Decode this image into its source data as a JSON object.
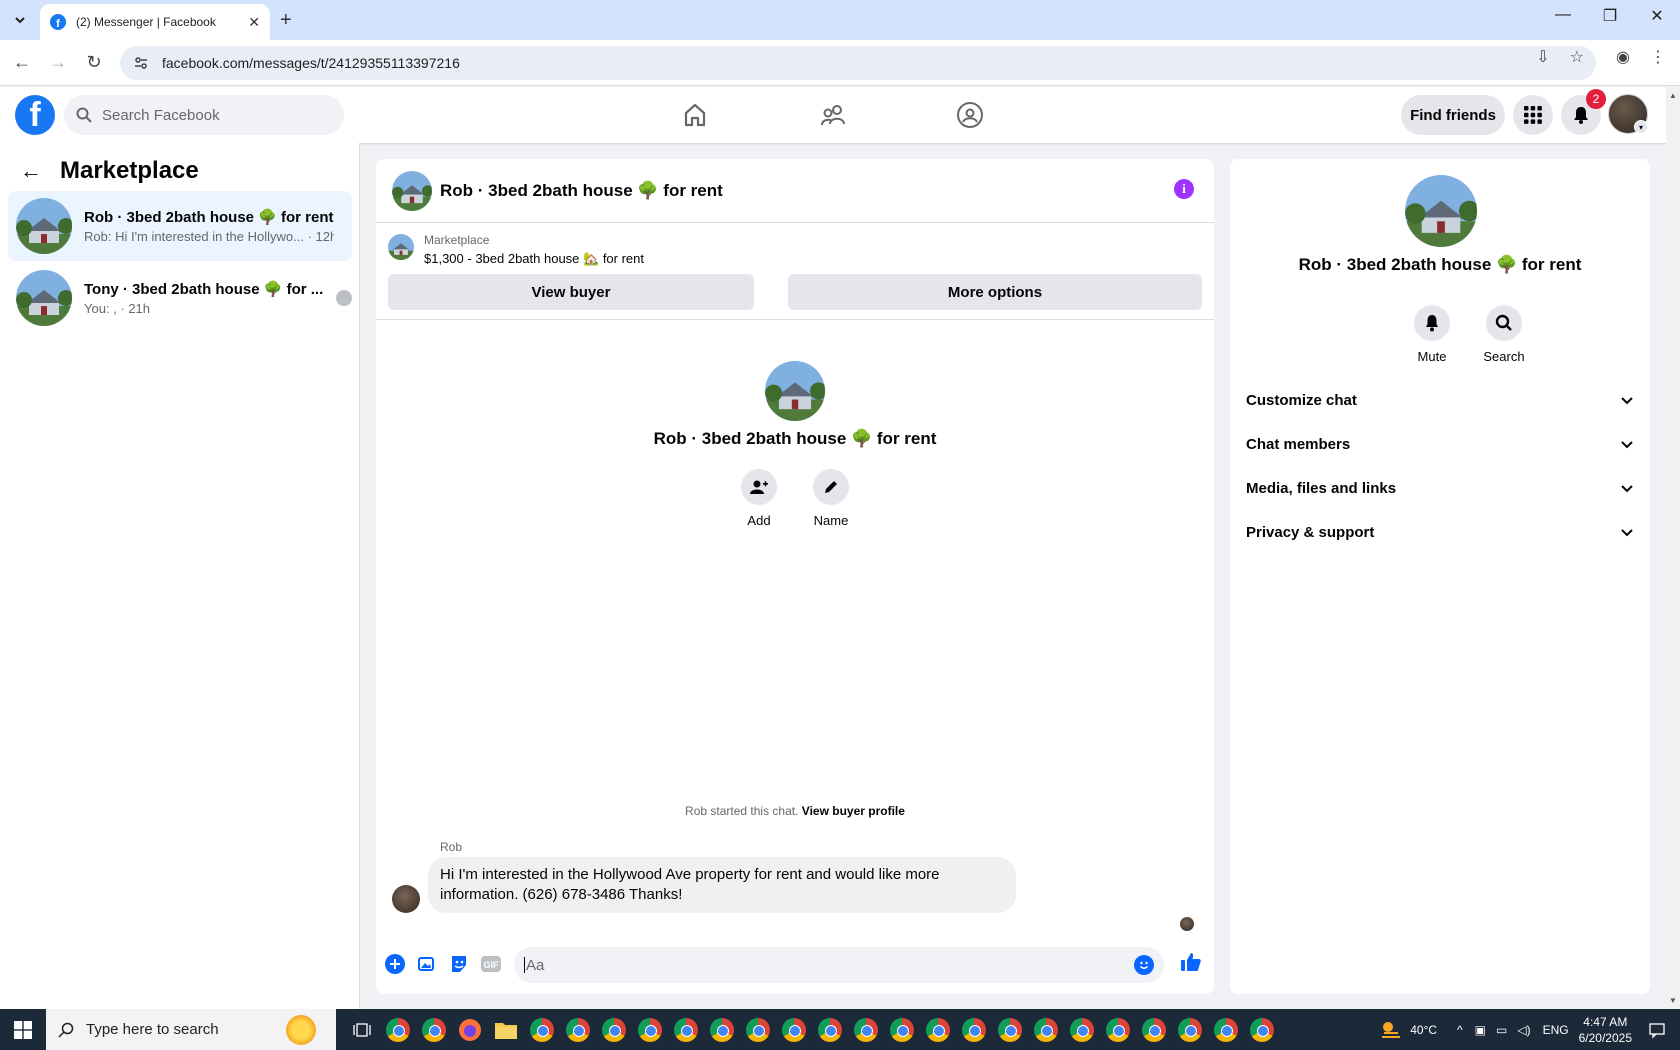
{
  "browser": {
    "tab_title": "(2) Messenger | Facebook",
    "url": "facebook.com/messages/t/24129355113397216"
  },
  "fb": {
    "search_placeholder": "Search Facebook",
    "find_friends": "Find friends",
    "notif_count": "2"
  },
  "left": {
    "title": "Marketplace",
    "conversations": [
      {
        "name": "Rob · 3bed 2bath house 🌳 for rent",
        "preview": "Rob: Hi I'm interested in the Hollywo... · 12h",
        "active": true
      },
      {
        "name": "Tony · 3bed 2bath house 🌳 for ...",
        "preview": "You: , · 21h",
        "active": false
      }
    ]
  },
  "chat": {
    "header_title": "Rob · 3bed 2bath house 🌳 for rent",
    "marketplace_label": "Marketplace",
    "listing": "$1,300 - 3bed 2bath house 🏡 for rent",
    "view_buyer": "View buyer",
    "more_options": "More options",
    "center_name": "Rob · 3bed 2bath house 🌳 for rent",
    "add_label": "Add",
    "name_label": "Name",
    "started_text": "Rob started this chat.",
    "view_buyer_profile": "View buyer profile",
    "sender": "Rob",
    "message": "Hi I'm interested in the Hollywood Ave property for rent and would like more information. (626) 678-3486 Thanks!",
    "composer_placeholder": "Aa"
  },
  "right": {
    "name": "Rob · 3bed 2bath house 🌳 for rent",
    "mute": "Mute",
    "search": "Search",
    "sections": [
      "Customize chat",
      "Chat members",
      "Media, files and links",
      "Privacy & support"
    ]
  },
  "taskbar": {
    "search_placeholder": "Type here to search",
    "temp": "40°C",
    "lang": "ENG",
    "time": "4:47 AM",
    "date": "6/20/2025"
  },
  "colors": {
    "accent": "#0866ff",
    "fb_blue": "#1877f2",
    "info": "#a033ff",
    "badge": "#e41e3f"
  }
}
